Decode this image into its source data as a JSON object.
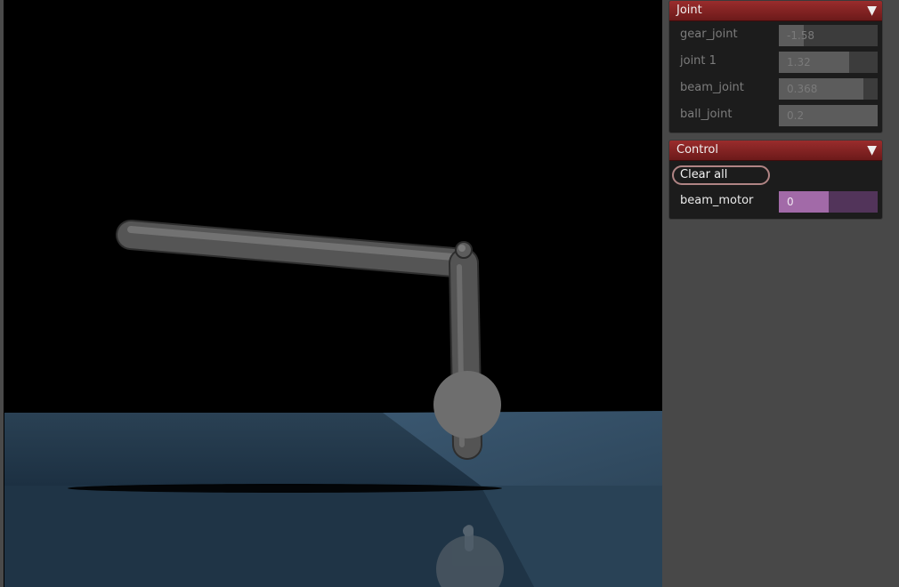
{
  "joint_panel": {
    "title": "Joint",
    "rows": [
      {
        "label": "gear_joint",
        "value": "-1.58",
        "fill": 0.25
      },
      {
        "label": "joint 1",
        "value": "1.32",
        "fill": 0.71
      },
      {
        "label": "beam_joint",
        "value": "0.368",
        "fill": 0.86
      },
      {
        "label": "ball_joint",
        "value": "0.2",
        "fill": 1.0
      }
    ]
  },
  "control_panel": {
    "title": "Control",
    "clear_label": "Clear all",
    "motor": {
      "label": "beam_motor",
      "value": "0",
      "fill": 0.5
    }
  }
}
